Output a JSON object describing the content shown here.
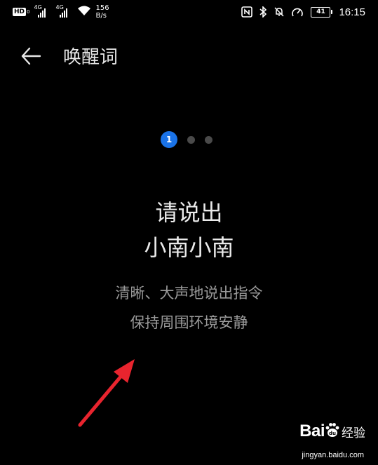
{
  "status_bar": {
    "network_badge": "HD",
    "network_badge_sub": "0",
    "signal1_tag": "4G",
    "signal2_tag": "4G",
    "speed_value": "156",
    "speed_unit": "B/s",
    "battery_level": "41",
    "time": "16:15",
    "icons": [
      "hd-icon",
      "signal-icon",
      "signal-icon",
      "wifi-icon",
      "nfc-icon",
      "bluetooth-icon",
      "mute-icon",
      "power-saving-icon",
      "battery-icon"
    ]
  },
  "app_bar": {
    "back_icon": "back-arrow-icon",
    "title": "唤醒词"
  },
  "pager": {
    "active_index": "1",
    "total": 3
  },
  "main": {
    "heading_line1": "请说出",
    "heading_line2": "小南小南",
    "hint_line1": "清晰、大声地说出指令",
    "hint_line2": "保持周围环境安静"
  },
  "annotation": {
    "arrow_color": "#e8242e"
  },
  "watermark": {
    "brand_text": "Bai",
    "brand_suffix": "经验",
    "url": "jingyan.baidu.com"
  },
  "colors": {
    "background": "#000000",
    "accent": "#1a73e8",
    "primary_text": "#eaeaea",
    "secondary_text": "#9a9a9a"
  }
}
